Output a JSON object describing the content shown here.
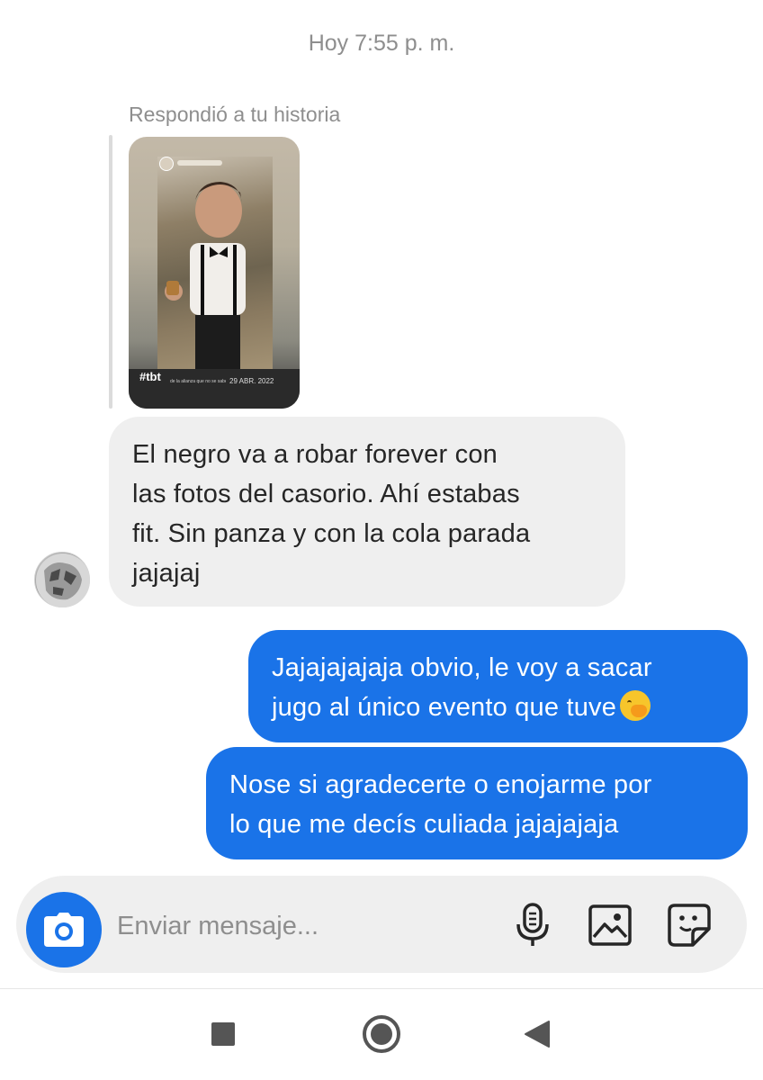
{
  "thread": {
    "timestamp": "Hoy 7:55 p. m.",
    "reply_label": "Respondió a tu historia"
  },
  "story": {
    "tag": "#tbt",
    "date": "29 ABR. 2022",
    "caption": "de la alianza que no se sabe"
  },
  "messages": [
    {
      "direction": "incoming",
      "lines": [
        "El negro va a robar forever con",
        "las fotos del casorio. Ahí estabas",
        "fit. Sin panza y con la cola parada",
        "jajajaj"
      ]
    },
    {
      "direction": "outgoing",
      "lines": [
        "Jajajajajaja obvio, le voy a sacar",
        "jugo al único evento que tuve"
      ],
      "emoji": "hand-over-mouth-emoji"
    },
    {
      "direction": "outgoing",
      "lines": [
        "Nose si agradecerte o enojarme por",
        "lo que me decís culiada jajajajaja"
      ]
    }
  ],
  "composer": {
    "placeholder": "Enviar mensaje...",
    "icons": [
      "camera-icon",
      "microphone-icon",
      "gallery-icon",
      "sticker-icon"
    ]
  },
  "navbar": {
    "icons": [
      "recents-square-icon",
      "home-circle-icon",
      "back-triangle-icon"
    ]
  },
  "colors": {
    "outgoing_bubble": "#1a73e8",
    "incoming_bubble": "#efefef",
    "muted_text": "#8e8e8e"
  }
}
